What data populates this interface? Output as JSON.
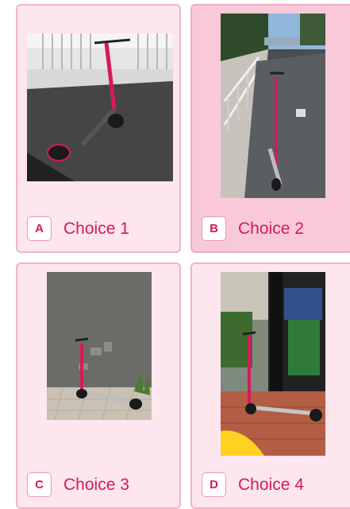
{
  "colors": {
    "accent": "#d7195c",
    "card_bg": "#fde6ee",
    "card_selected_bg": "#f9c9d9",
    "card_border": "#f0b4c9"
  },
  "choices": [
    {
      "letter": "A",
      "label": "Choice 1",
      "selected": false,
      "image": "scooter-photo"
    },
    {
      "letter": "B",
      "label": "Choice 2",
      "selected": true,
      "image": "scooter-photo"
    },
    {
      "letter": "C",
      "label": "Choice 3",
      "selected": false,
      "image": "scooter-photo"
    },
    {
      "letter": "D",
      "label": "Choice 4",
      "selected": false,
      "image": "scooter-photo"
    }
  ]
}
